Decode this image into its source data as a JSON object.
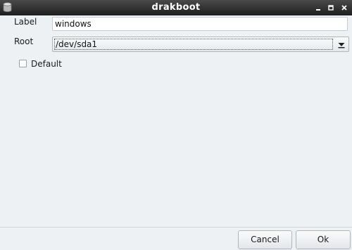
{
  "window": {
    "title": "drakboot",
    "app_icon": "disk-icon",
    "controls": [
      "minimize-icon",
      "maximize-icon",
      "close-icon"
    ]
  },
  "form": {
    "label_text": "Label",
    "label_value": "windows",
    "root_text": "Root",
    "root_value": "/dev/sda1",
    "default_text": "Default",
    "default_checked": false
  },
  "buttons": {
    "cancel": "Cancel",
    "ok": "Ok"
  }
}
